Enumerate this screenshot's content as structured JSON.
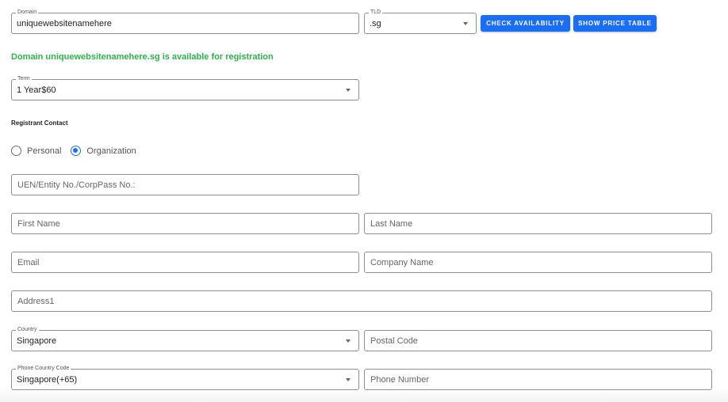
{
  "domain_search": {
    "domain_label": "Domain",
    "domain_value": "uniquewebsitenamehere",
    "tld_label": "TLD",
    "tld_value": ".sg",
    "check_button": "CHECK AVAILABILITY",
    "price_button": "SHOW PRICE TABLE"
  },
  "status": {
    "message": "Domain uniquewebsitenamehere.sg is available for registration",
    "color": "#2bb34b"
  },
  "term": {
    "label": "Term",
    "value": "1 Year$60"
  },
  "registrant": {
    "title": "Registrant Contact",
    "types": [
      {
        "label": "Personal",
        "checked": false
      },
      {
        "label": "Organization",
        "checked": true
      }
    ],
    "fields": {
      "uen_placeholder": "UEN/Entity No./CorpPass No.:",
      "first_name_placeholder": "First Name",
      "last_name_placeholder": "Last Name",
      "email_placeholder": "Email",
      "company_placeholder": "Company Name",
      "address1_placeholder": "Address1",
      "country_label": "Country",
      "country_value": "Singapore",
      "postal_placeholder": "Postal Code",
      "phone_code_label": "Phone Country Code",
      "phone_code_value": "Singapore(+65)",
      "phone_placeholder": "Phone Number"
    }
  },
  "colors": {
    "accent": "#1a6ef5",
    "success": "#2bb34b"
  }
}
